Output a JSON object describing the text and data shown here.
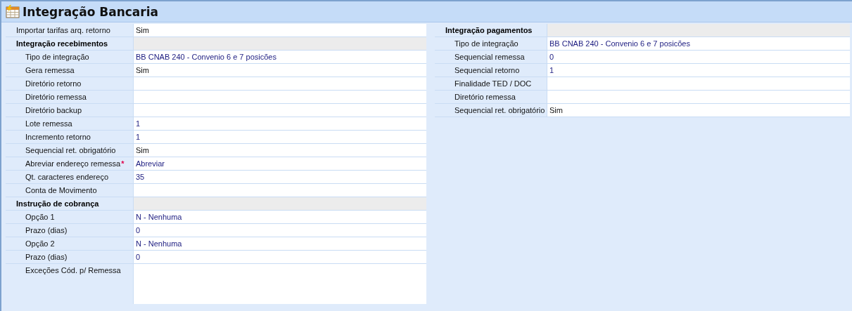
{
  "window": {
    "title": "Integração Bancaria"
  },
  "left_grid": {
    "rows": [
      {
        "kind": "flag",
        "label": "Importar tarifas arq. retorno",
        "value": "Sim"
      },
      {
        "kind": "section",
        "label": "Integração recebimentos",
        "children": [
          {
            "kind": "lookup",
            "label": "Tipo de integração",
            "value": "BB CNAB 240 - Convenio 6 e 7 posicões"
          },
          {
            "kind": "flag",
            "label": "Gera remessa",
            "value": "Sim"
          },
          {
            "kind": "field",
            "label": "Diretório retorno"
          },
          {
            "kind": "field",
            "label": "Diretório remessa"
          },
          {
            "kind": "field",
            "label": "Diretório backup"
          },
          {
            "kind": "lookup",
            "label": "Lote remessa",
            "value": "1"
          },
          {
            "kind": "lookup",
            "label": "Incremento retorno",
            "value": "1"
          },
          {
            "kind": "flag",
            "label": "Sequencial ret. obrigatório",
            "value": "Sim"
          },
          {
            "kind": "lookup",
            "label": "Abreviar endereço remessa",
            "required_mark": "*",
            "value": "Abreviar"
          },
          {
            "kind": "lookup",
            "label": "Qt. caracteres endereço",
            "value": "35"
          },
          {
            "kind": "field",
            "label": "Conta de Movimento"
          }
        ]
      },
      {
        "kind": "section",
        "label": "Instrução de cobrança",
        "children": [
          {
            "kind": "lookup",
            "label": "Opção 1",
            "value": "N - Nenhuma"
          },
          {
            "kind": "lookup",
            "label": "Prazo (dias)",
            "value": "0"
          },
          {
            "kind": "lookup",
            "label": "Opção 2",
            "value": "N - Nenhuma"
          },
          {
            "kind": "lookup",
            "label": "Prazo (dias)",
            "value": "0"
          },
          {
            "kind": "memo",
            "label": "Exceções Cód. p/ Remessa"
          }
        ]
      }
    ]
  },
  "right_grid": {
    "rows": [
      {
        "kind": "section",
        "label": "Integração pagamentos",
        "children": [
          {
            "kind": "lookup",
            "label": "Tipo de integração",
            "value": "BB CNAB 240 - Convenio 6 e 7 posicões"
          },
          {
            "kind": "lookup",
            "label": "Sequencial remessa",
            "value": "0"
          },
          {
            "kind": "lookup",
            "label": "Sequencial retorno",
            "value": "1"
          },
          {
            "kind": "field",
            "label": "Finalidade TED / DOC"
          },
          {
            "kind": "field",
            "label": "Diretório remessa"
          },
          {
            "kind": "flag",
            "label": "Sequencial ret. obrigatório",
            "value": "Sim"
          }
        ]
      }
    ]
  }
}
